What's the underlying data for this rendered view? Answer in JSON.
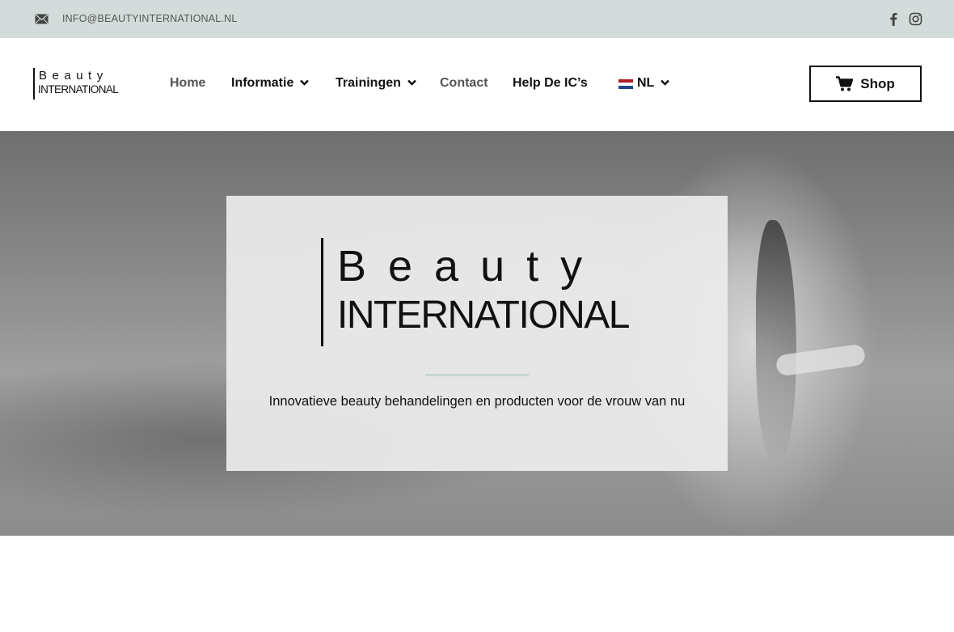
{
  "topbar": {
    "email": "INFO@BEAUTYINTERNATIONAL.NL",
    "icons": [
      "mail-icon",
      "facebook-icon",
      "instagram-icon"
    ]
  },
  "logo": {
    "line1": "Beauty",
    "line2": "INTERNATIONAL"
  },
  "nav": {
    "items": [
      {
        "label": "Home"
      },
      {
        "label": "Informatie"
      },
      {
        "label": "Trainingen"
      },
      {
        "label": "Contact"
      },
      {
        "label": "Help De IC’s"
      },
      {
        "label": "NL"
      }
    ]
  },
  "shop": {
    "label": "Shop",
    "icon": "cart-icon"
  },
  "hero": {
    "logo_line1": "Beauty",
    "logo_line2": "INTERNATIONAL",
    "tagline": "Innovatieve beauty behandelingen en producten voor de vrouw van nu"
  },
  "colors": {
    "topbar_bg": "#d3dcdb",
    "divider": "#c9d5d3",
    "text": "#111111"
  }
}
